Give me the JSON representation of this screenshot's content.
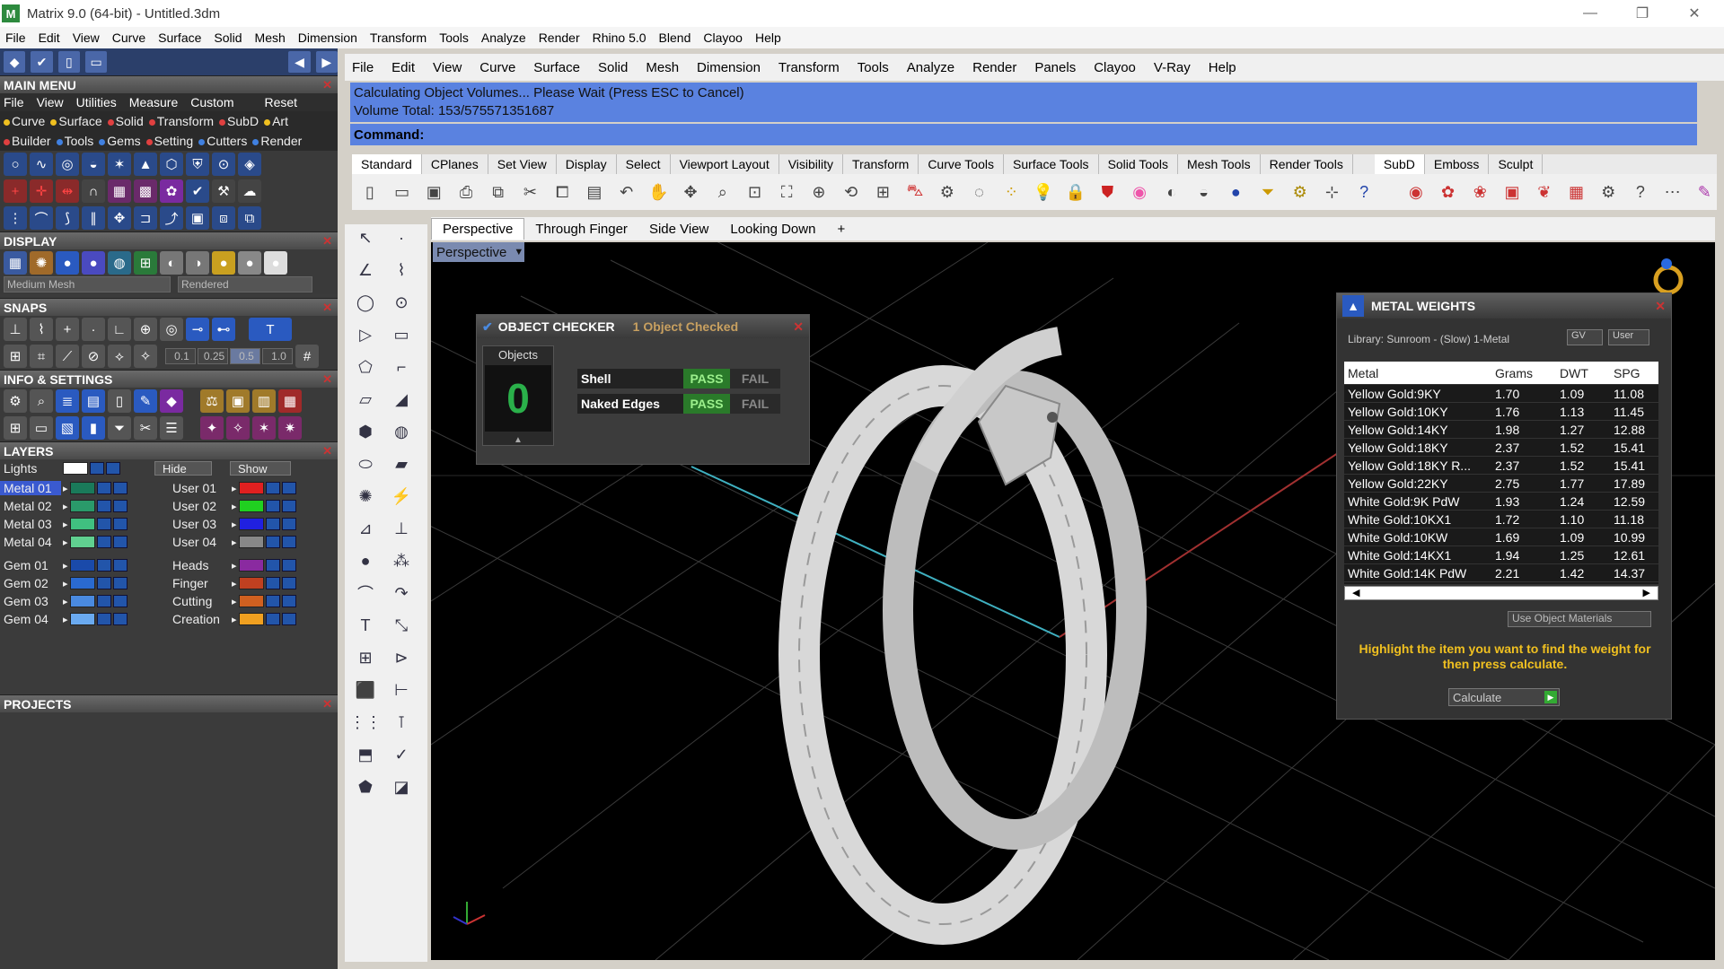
{
  "window": {
    "title": "Matrix 9.0 (64-bit) - Untitled.3dm",
    "minimize": "—",
    "restore": "❐",
    "close": "✕"
  },
  "menu1": [
    "File",
    "Edit",
    "View",
    "Curve",
    "Surface",
    "Solid",
    "Mesh",
    "Dimension",
    "Transform",
    "Tools",
    "Analyze",
    "Render",
    "Rhino 5.0",
    "Blend",
    "Clayoo",
    "Help"
  ],
  "menu2": [
    "File",
    "Edit",
    "View",
    "Curve",
    "Surface",
    "Solid",
    "Mesh",
    "Dimension",
    "Transform",
    "Tools",
    "Analyze",
    "Render",
    "Panels",
    "Clayoo",
    "V-Ray",
    "Help"
  ],
  "command": {
    "line1": "Calculating Object Volumes... Please Wait (Press ESC to Cancel)",
    "line2": "Volume Total: 153/575571351687",
    "label": "Command:"
  },
  "toolbar_tabs": [
    "Standard",
    "CPlanes",
    "Set View",
    "Display",
    "Select",
    "Viewport Layout",
    "Visibility",
    "Transform",
    "Curve Tools",
    "Surface Tools",
    "Solid Tools",
    "Mesh Tools",
    "Render Tools",
    "SubD",
    "Emboss",
    "Sculpt"
  ],
  "view_tabs": [
    "Perspective",
    "Through Finger",
    "Side View",
    "Looking Down"
  ],
  "viewport_label": "Perspective",
  "main_menu": {
    "header": "MAIN MENU",
    "menu": [
      "File",
      "View",
      "Utilities",
      "Measure",
      "Custom",
      "Reset"
    ],
    "row1": [
      {
        "label": "Curve",
        "color": "#f0c020"
      },
      {
        "label": "Surface",
        "color": "#f0c020"
      },
      {
        "label": "Solid",
        "color": "#e04040"
      },
      {
        "label": "Transform",
        "color": "#e04040"
      },
      {
        "label": "SubD",
        "color": "#e04040"
      },
      {
        "label": "Art",
        "color": "#f0c020"
      }
    ],
    "row2": [
      {
        "label": "Builder",
        "color": "#e04040"
      },
      {
        "label": "Tools",
        "color": "#4080e0"
      },
      {
        "label": "Gems",
        "color": "#4080e0"
      },
      {
        "label": "Setting",
        "color": "#e04040"
      },
      {
        "label": "Cutters",
        "color": "#4080e0"
      },
      {
        "label": "Render",
        "color": "#4080e0"
      }
    ]
  },
  "display": {
    "header": "DISPLAY",
    "mesh": "Medium Mesh",
    "mode": "Rendered"
  },
  "snaps": {
    "header": "SNAPS",
    "values": [
      "0.1",
      "0.25",
      "0.5",
      "1.0"
    ]
  },
  "info": {
    "header": "INFO & SETTINGS"
  },
  "layers": {
    "header": "LAYERS",
    "lights": "Lights",
    "hide": "Hide",
    "show": "Show",
    "left": [
      {
        "name": "Metal 01",
        "color": "#1a7a5a"
      },
      {
        "name": "Metal 02",
        "color": "#2a9a6a"
      },
      {
        "name": "Metal 03",
        "color": "#40c080"
      },
      {
        "name": "Metal 04",
        "color": "#60d090"
      },
      {
        "name": "Gem 01",
        "color": "#1a4aaa"
      },
      {
        "name": "Gem 02",
        "color": "#2a6ad0"
      },
      {
        "name": "Gem 03",
        "color": "#4a8ae0"
      },
      {
        "name": "Gem 04",
        "color": "#6aaaf0"
      }
    ],
    "right": [
      {
        "name": "User 01",
        "color": "#e02020"
      },
      {
        "name": "User 02",
        "color": "#20d020"
      },
      {
        "name": "User 03",
        "color": "#2020e0"
      },
      {
        "name": "User 04",
        "color": "#888888"
      },
      {
        "name": "Heads",
        "color": "#8a2aa0"
      },
      {
        "name": "Finger",
        "color": "#c04020"
      },
      {
        "name": "Cutting",
        "color": "#d06020"
      },
      {
        "name": "Creation",
        "color": "#f0a020"
      }
    ]
  },
  "projects": {
    "header": "PROJECTS"
  },
  "object_checker": {
    "title": "OBJECT CHECKER",
    "status": "1 Object Checked",
    "objects_label": "Objects",
    "checks": [
      {
        "name": "Shell",
        "pass": "PASS",
        "fail": "FAIL"
      },
      {
        "name": "Naked Edges",
        "pass": "PASS",
        "fail": "FAIL"
      }
    ]
  },
  "metal_weights": {
    "title": "METAL WEIGHTS",
    "library": "Library: Sunroom - (Slow) 1-Metal",
    "gv": "GV",
    "user": "User",
    "columns": [
      "Metal",
      "Grams",
      "DWT",
      "SPG"
    ],
    "rows": [
      [
        "Yellow Gold:9KY",
        "1.70",
        "1.09",
        "11.08"
      ],
      [
        "Yellow Gold:10KY",
        "1.76",
        "1.13",
        "11.45"
      ],
      [
        "Yellow Gold:14KY",
        "1.98",
        "1.27",
        "12.88"
      ],
      [
        "Yellow Gold:18KY",
        "2.37",
        "1.52",
        "15.41"
      ],
      [
        "Yellow Gold:18KY R...",
        "2.37",
        "1.52",
        "15.41"
      ],
      [
        "Yellow Gold:22KY",
        "2.75",
        "1.77",
        "17.89"
      ],
      [
        "White Gold:9K PdW",
        "1.93",
        "1.24",
        "12.59"
      ],
      [
        "White Gold:10KX1",
        "1.72",
        "1.10",
        "11.18"
      ],
      [
        "White Gold:10KW",
        "1.69",
        "1.09",
        "10.99"
      ],
      [
        "White Gold:14KX1",
        "1.94",
        "1.25",
        "12.61"
      ],
      [
        "White Gold:14K PdW",
        "2.21",
        "1.42",
        "14.37"
      ]
    ],
    "use_materials": "Use Object Materials",
    "message": "Highlight the item you want to find the weight for then press calculate.",
    "calculate": "Calculate"
  }
}
